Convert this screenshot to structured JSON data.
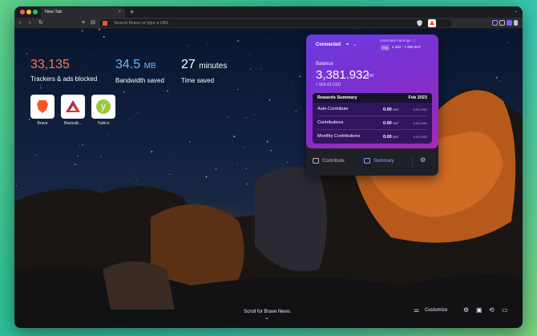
{
  "tab": {
    "title": "New Tab",
    "close": "×",
    "new_tab": "+"
  },
  "url_bar": {
    "placeholder": "Search Brave or type a URL"
  },
  "toolbar": {
    "back": "‹",
    "forward": "›",
    "reload": "↻",
    "bookmark": "⊟",
    "sidebar": "≡",
    "chevron": "⌄"
  },
  "stats": [
    {
      "number": "33,135",
      "unit": "",
      "label": "Trackers & ads blocked",
      "color": "#fb7a52"
    },
    {
      "number": "34.5",
      "unit": "MB",
      "label": "Bandwidth saved",
      "color": "#6fb6ff"
    },
    {
      "number": "27",
      "unit": "minutes",
      "label": "Time saved",
      "color": "#ffffff"
    }
  ],
  "top_sites": [
    {
      "label": "Brave",
      "icon": "brave-lion-icon"
    },
    {
      "label": "Basicatt...",
      "icon": "bat-triangle-icon"
    },
    {
      "label": "Yubico",
      "icon": "yubico-icon"
    }
  ],
  "rewards": {
    "status": "Connected",
    "estimated_label": "Estimated earnings",
    "estimated_info": "ⓘ",
    "estimated_badge": "Feb",
    "estimated_range": "4.322 - 7.459 BAT",
    "balance_label": "Balance",
    "balance": "3,381.932",
    "balance_unit": "BAT",
    "balance_usd": "≈ 500.43 USD",
    "summary_title": "Rewards Summary",
    "summary_month": "Feb 2023",
    "rows": [
      {
        "label": "Auto-Contribute",
        "value": "0.00",
        "unit": "BAT",
        "usd": "0.00 USD"
      },
      {
        "label": "Contributions",
        "value": "0.00",
        "unit": "BAT",
        "usd": "0.00 USD"
      },
      {
        "label": "Monthly Contributions",
        "value": "0.00",
        "unit": "BAT",
        "usd": "0.00 USD"
      }
    ],
    "footer": {
      "contribute": "Contribute",
      "summary": "Summary",
      "settings": "⚙"
    }
  },
  "scroll_news": {
    "label": "Scroll for Brave News",
    "chevron": "⌄"
  },
  "bottom_bar": {
    "customize": "Customize",
    "customize_icon": "⚌",
    "settings": "⚙",
    "bookmarks": "▣",
    "history": "⟲",
    "video": "▭"
  },
  "colors": {
    "accent": "#7d2fd0",
    "brave_orange": "#fb542b"
  }
}
